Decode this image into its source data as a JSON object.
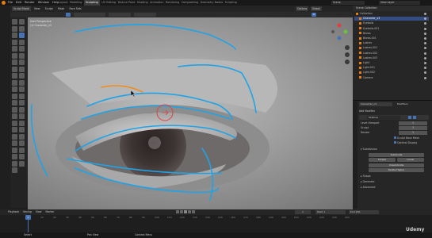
{
  "menu": {
    "items": [
      "File",
      "Edit",
      "Render",
      "Window",
      "Help"
    ],
    "workspaces": [
      "Layout",
      "Modeling",
      "Sculpting",
      "UV Editing",
      "Texture Paint",
      "Shading",
      "Animation",
      "Rendering",
      "Compositing",
      "Geometry Nodes",
      "Scripting"
    ],
    "active_workspace": "Sculpting",
    "scene_label": "Scene",
    "view_layer_label": "View Layer"
  },
  "header": {
    "mode": "Sculpt Mode",
    "menus": [
      "View",
      "Sculpt",
      "Mask",
      "Face Sets"
    ],
    "symmetry_label": "X",
    "right_menus": [
      "Options",
      "Global"
    ]
  },
  "viewport": {
    "view_name": "User Perspective",
    "object_info": "(1) Character_v3"
  },
  "outliner": {
    "title": "Scene Collection",
    "items": [
      {
        "label": "Collection"
      },
      {
        "label": "Character_v3"
      },
      {
        "label": "Eyeballs"
      },
      {
        "label": "Eyeballs.001"
      },
      {
        "label": "Brows"
      },
      {
        "label": "Brows.001"
      },
      {
        "label": "Lashes"
      },
      {
        "label": "Lashes.001"
      },
      {
        "label": "Lashes.002"
      },
      {
        "label": "Lashes.003"
      },
      {
        "label": "Light"
      },
      {
        "label": "Light.001"
      },
      {
        "label": "Light.002"
      },
      {
        "label": "Camera"
      }
    ],
    "selected_index": 1
  },
  "properties": {
    "object_name": "Character_v3",
    "modifier_tab": "Modifiers",
    "add_modifier": "Add Modifier",
    "modifier_name": "Multires",
    "rows": [
      {
        "label": "Level Viewport",
        "value": "3"
      },
      {
        "label": "Sculpt",
        "value": "3"
      },
      {
        "label": "Render",
        "value": "3"
      }
    ],
    "checkbox_sculpt_base": "Sculpt Base Mesh",
    "checkbox_optimal": "Optimal Display",
    "subdivision_label": "Subdivision",
    "buttons": {
      "subdivide": "Subdivide",
      "simple": "Simple",
      "linear": "Linear",
      "unsubdivide": "Unsubdivide",
      "delete_higher": "Delete Higher"
    },
    "sections": [
      "Shape",
      "Generate",
      "Advanced"
    ]
  },
  "timeline": {
    "menus": [
      "Playback",
      "Keying",
      "View",
      "Marker"
    ],
    "current_frame": "1",
    "start_label": "Start",
    "start": "1",
    "end_label": "End",
    "end": "250",
    "ticks": [
      "0",
      "10",
      "20",
      "30",
      "40",
      "50",
      "60",
      "70",
      "80",
      "90",
      "100",
      "110",
      "120",
      "130",
      "140",
      "150",
      "160",
      "170",
      "180",
      "190",
      "200",
      "210",
      "220",
      "230",
      "240",
      "250"
    ]
  },
  "status": {
    "left": "Select",
    "middle": "Pan View",
    "right": "Context Menu"
  },
  "watermark": "Udemy",
  "colors": {
    "accent": "#4772b3",
    "stroke_blue": "#1fa3e6",
    "stroke_orange": "#f08c1e",
    "brush_red": "#e04040"
  }
}
